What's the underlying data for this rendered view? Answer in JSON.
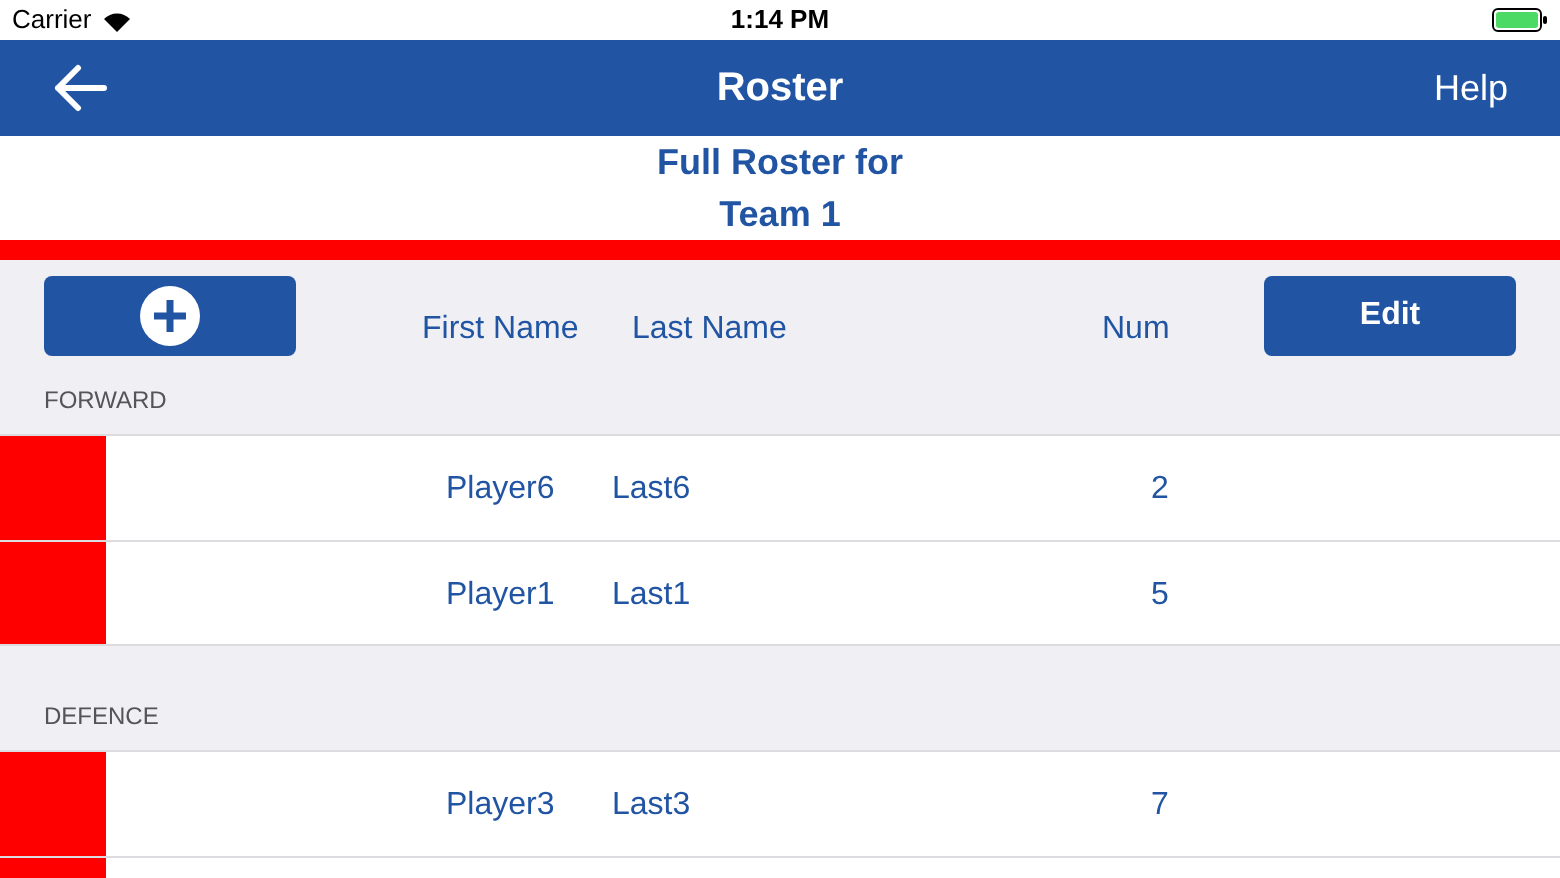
{
  "status_bar": {
    "carrier": "Carrier",
    "time": "1:14 PM"
  },
  "nav": {
    "title": "Roster",
    "right_button": "Help"
  },
  "heading": [
    "Full Roster for",
    "Team 1"
  ],
  "columns": [
    "First Name",
    "Last Name",
    "Num"
  ],
  "edit_button": "Edit",
  "sections": [
    {
      "title": "FORWARD",
      "rows": [
        {
          "first": "Player6",
          "last": "Last6",
          "num": "2",
          "color": "#ff0000"
        },
        {
          "first": "Player1",
          "last": "Last1",
          "num": "5",
          "color": "#ff0000"
        }
      ]
    },
    {
      "title": "DEFENCE",
      "rows": [
        {
          "first": "Player3",
          "last": "Last3",
          "num": "7",
          "color": "#ff0000"
        },
        {
          "color": "#ff0000"
        }
      ]
    }
  ]
}
